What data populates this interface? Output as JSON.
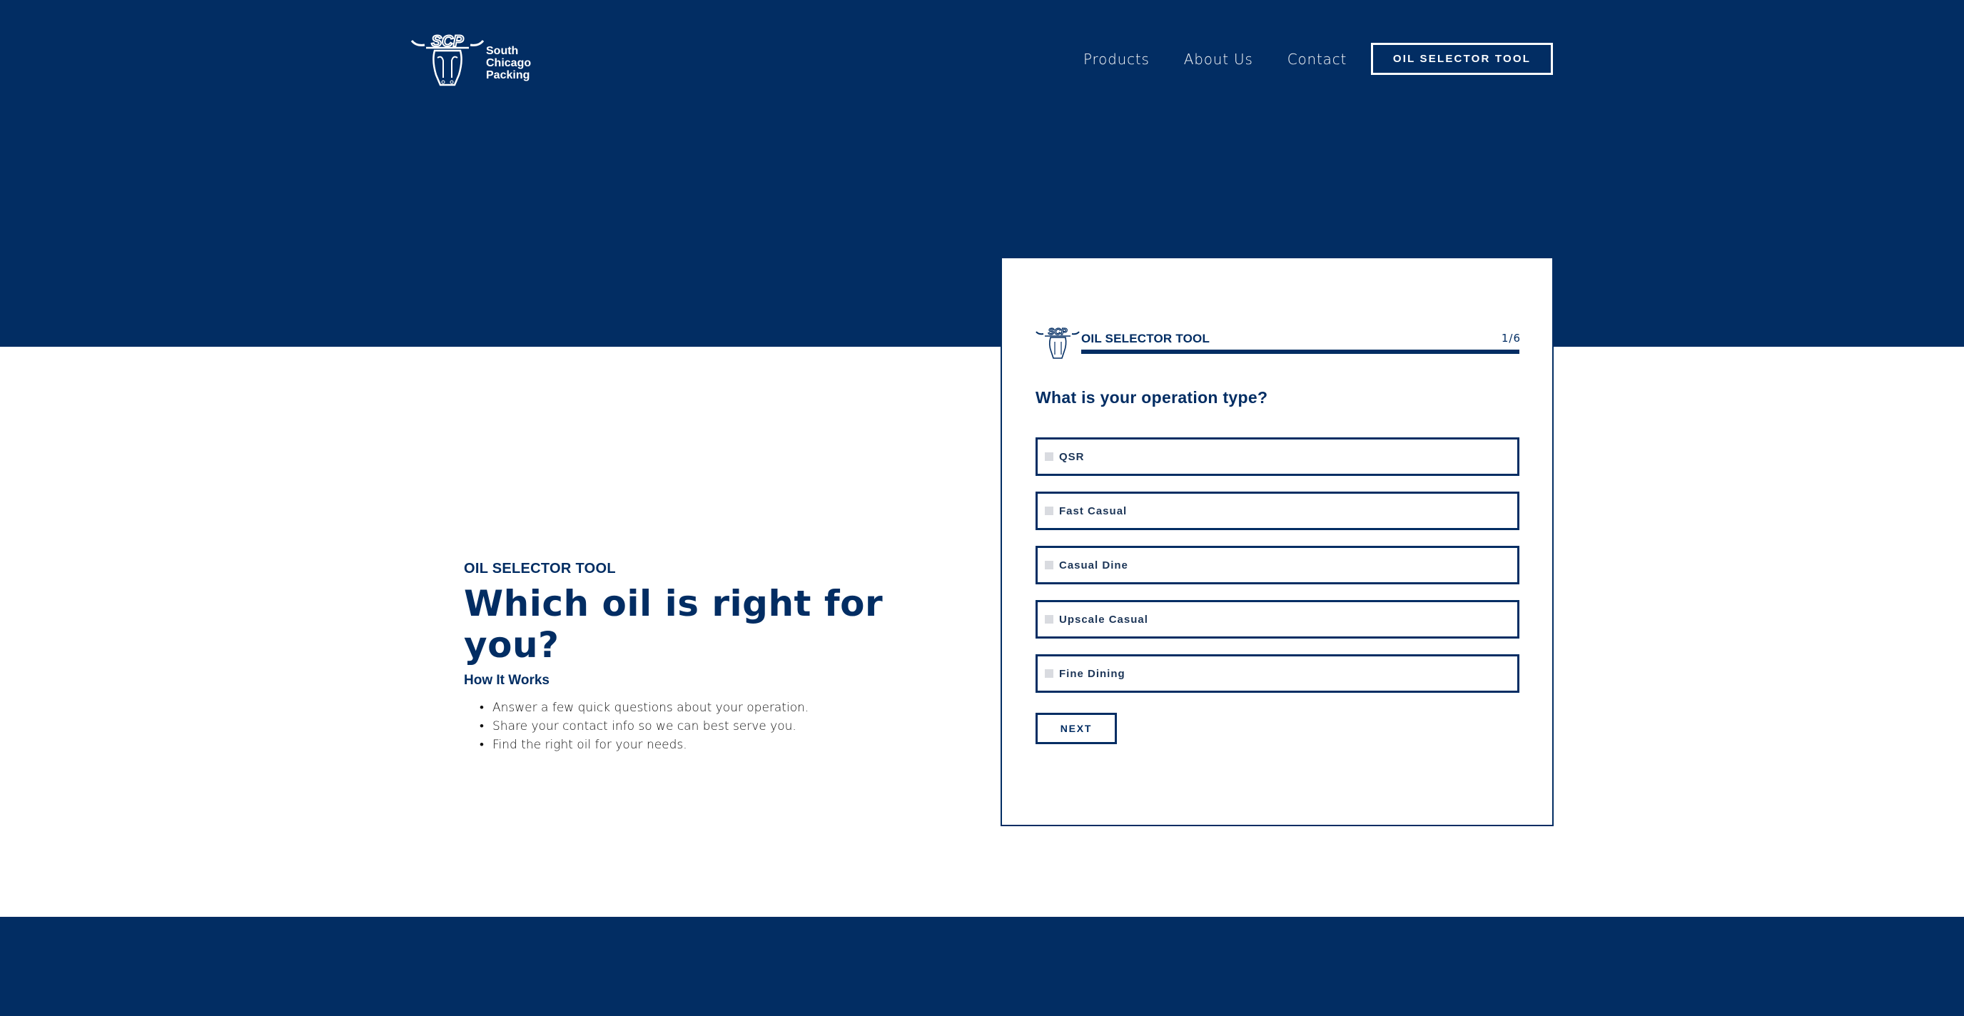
{
  "brand": {
    "logo_mark": "SCP",
    "name_lines": [
      "South",
      "Chicago",
      "Packing"
    ]
  },
  "nav": {
    "items": [
      {
        "label": "Products"
      },
      {
        "label": "About Us"
      },
      {
        "label": "Contact"
      }
    ],
    "cta_label": "OIL SELECTOR TOOL"
  },
  "intro": {
    "eyebrow": "OIL SELECTOR TOOL",
    "title": "Which oil is right for you?",
    "subtitle": "How It Works",
    "steps": [
      "Answer a few quick questions about your operation.",
      "Share your contact info so we can best serve you.",
      "Find the right oil for your needs."
    ]
  },
  "card": {
    "title": "OIL SELECTOR TOOL",
    "step_label": "1/6",
    "progress_percent": 100,
    "question": "What is your operation type?",
    "options": [
      {
        "label": "QSR",
        "checked": false
      },
      {
        "label": "Fast Casual",
        "checked": false
      },
      {
        "label": "Casual Dine",
        "checked": false
      },
      {
        "label": "Upscale Casual",
        "checked": false
      },
      {
        "label": "Fine Dining",
        "checked": false
      }
    ],
    "next_label": "NEXT"
  },
  "colors": {
    "brand_navy": "#022d63",
    "white": "#ffffff",
    "checkbox_gray": "#d9dbe0"
  }
}
